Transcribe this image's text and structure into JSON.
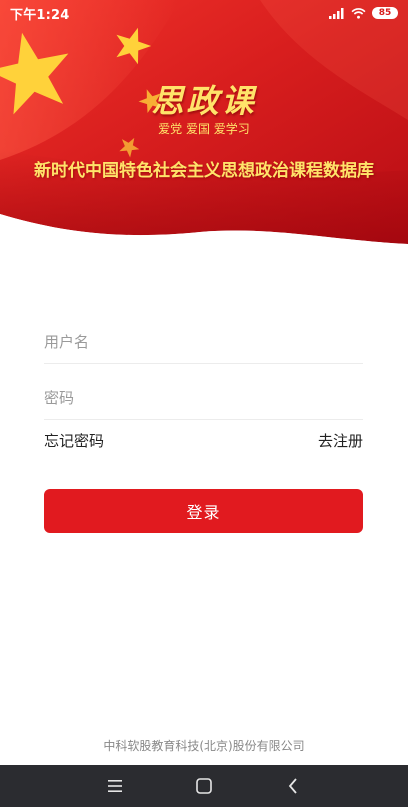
{
  "status_bar": {
    "time": "下午1:24",
    "battery": "85",
    "icons": [
      "signal-icon",
      "wifi-icon",
      "battery-icon"
    ]
  },
  "brand": {
    "title": "思政课",
    "slogan": "爱党 爱国 爱学习",
    "subtitle": "新时代中国特色社会主义思想政治课程数据库"
  },
  "login_form": {
    "username_placeholder": "用户名",
    "password_placeholder": "密码",
    "forgot_password": "忘记密码",
    "register": "去注册",
    "login_button": "登录"
  },
  "footer": {
    "company": "中科软股教育科技(北京)股份有限公司"
  },
  "nav_bar": {
    "icons": [
      "menu-icon",
      "home-icon",
      "back-icon"
    ]
  },
  "colors": {
    "primary_red": "#e11a1f",
    "flag_red": "#d81e1e",
    "gold": "#ffe36a",
    "nav_bar_bg": "#2b2c30",
    "footer_text": "#888888"
  }
}
